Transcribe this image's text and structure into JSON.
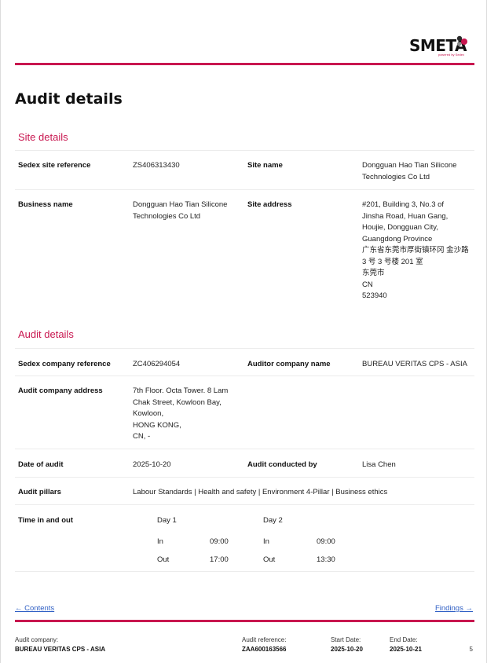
{
  "brand": {
    "name": "SMETA",
    "tagline": "powered by Sedex",
    "accent": "#c8164f"
  },
  "page_title": "Audit details",
  "site_details": {
    "title": "Site details",
    "sedex_site_reference_label": "Sedex site reference",
    "sedex_site_reference": "ZS406313430",
    "site_name_label": "Site name",
    "site_name": "Dongguan Hao Tian Silicone Technologies Co Ltd",
    "business_name_label": "Business name",
    "business_name": "Dongguan Hao Tian Silicone Technologies Co Ltd",
    "site_address_label": "Site address",
    "site_address_lines": [
      "#201, Building 3, No.3 of",
      "Jinsha Road, Huan  Gang,",
      "Houjie,  Dongguan City,",
      "Guangdong Province",
      "广东省东莞市厚街镇环冈 金沙路",
      "3 号 3 号楼 201 室",
      "东莞市",
      "CN",
      "523940"
    ]
  },
  "audit_details": {
    "title": "Audit details",
    "sedex_company_reference_label": "Sedex company reference",
    "sedex_company_reference": "ZC406294054",
    "auditor_company_name_label": "Auditor company name",
    "auditor_company_name": "BUREAU VERITAS CPS - ASIA",
    "audit_company_address_label": "Audit company address",
    "audit_company_address_lines": [
      "7th Floor. Octa Tower. 8 Lam",
      "Chak Street, Kowloon Bay,",
      "Kowloon,",
      "HONG KONG,",
      "CN, -"
    ],
    "date_of_audit_label": "Date of audit",
    "date_of_audit": "2025-10-20",
    "audit_conducted_by_label": "Audit conducted by",
    "audit_conducted_by": "Lisa Chen",
    "audit_pillars_label": "Audit pillars",
    "audit_pillars": "Labour Standards | Health and safety | Environment 4-Pillar | Business ethics",
    "time_label": "Time in and out",
    "days": [
      {
        "day": "Day 1",
        "in_label": "In",
        "in": "09:00",
        "out_label": "Out",
        "out": "17:00"
      },
      {
        "day": "Day 2",
        "in_label": "In",
        "in": "09:00",
        "out_label": "Out",
        "out": "13:30"
      }
    ]
  },
  "nav": {
    "prev": "← Contents",
    "next": "Findings →"
  },
  "footer": {
    "audit_company_label": "Audit company:",
    "audit_company": "BUREAU VERITAS CPS - ASIA",
    "audit_reference_label": "Audit reference:",
    "audit_reference": "ZAA600163566",
    "start_date_label": "Start Date:",
    "start_date": "2025-10-20",
    "end_date_label": "End Date:",
    "end_date": "2025-10-21",
    "page_number": "5"
  }
}
